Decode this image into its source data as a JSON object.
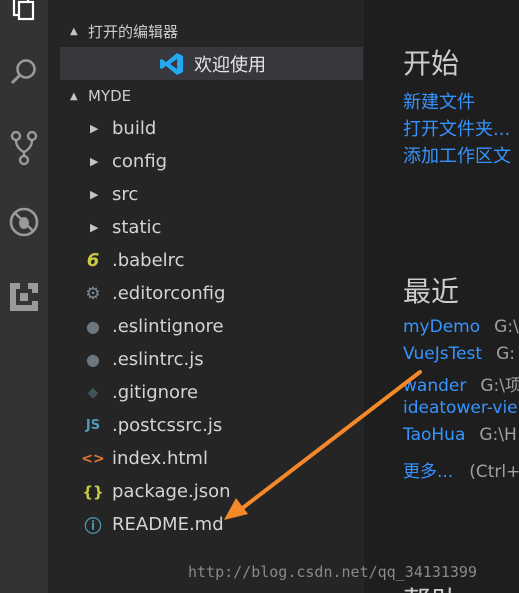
{
  "open_editors": {
    "header": "打开的编辑器",
    "items": [
      {
        "label": "欢迎使用"
      }
    ]
  },
  "explorer": {
    "header": "MYDE",
    "folders": [
      {
        "label": "build"
      },
      {
        "label": "config"
      },
      {
        "label": "src"
      },
      {
        "label": "static"
      }
    ],
    "files": [
      {
        "label": ".babelrc",
        "icon": "babel-icon",
        "glyph": "6",
        "color": "#cbcb41"
      },
      {
        "label": ".editorconfig",
        "icon": "gear-icon",
        "glyph": "⚙",
        "color": "#7f8b95"
      },
      {
        "label": ".eslintignore",
        "icon": "eslint-icon",
        "glyph": "●",
        "color": "#6d7780"
      },
      {
        "label": ".eslintrc.js",
        "icon": "eslint-icon",
        "glyph": "●",
        "color": "#6d7780"
      },
      {
        "label": ".gitignore",
        "icon": "git-icon",
        "glyph": "◆",
        "color": "#41535b"
      },
      {
        "label": ".postcssrc.js",
        "icon": "js-icon",
        "glyph": "JS",
        "color": "#519aba"
      },
      {
        "label": "index.html",
        "icon": "html-icon",
        "glyph": "<>",
        "color": "#e37933"
      },
      {
        "label": "package.json",
        "icon": "json-icon",
        "glyph": "{}",
        "color": "#cbcb41"
      },
      {
        "label": "README.md",
        "icon": "info-icon",
        "glyph": "ⓘ",
        "color": "#519aba"
      }
    ]
  },
  "welcome": {
    "start_title": "开始",
    "start_links": [
      "新建文件",
      "打开文件夹...",
      "添加工作区文"
    ],
    "recent_title": "最近",
    "recent": [
      {
        "name": "myDemo",
        "path": "G:\\"
      },
      {
        "name": "VueJsTest",
        "path": "G:"
      },
      {
        "name": "wander",
        "path": "G:\\项"
      },
      {
        "name": "ideatower-vie",
        "path": ""
      },
      {
        "name": "TaoHua",
        "path": "G:\\H"
      }
    ],
    "more_label": "更多...",
    "more_hint": "(Ctrl+",
    "help_title_partial": "帮助"
  },
  "watermark": "http://blog.csdn.net/qq_34131399",
  "colors": {
    "accent_link": "#3794ff",
    "annotation_arrow": "#f5892a"
  }
}
